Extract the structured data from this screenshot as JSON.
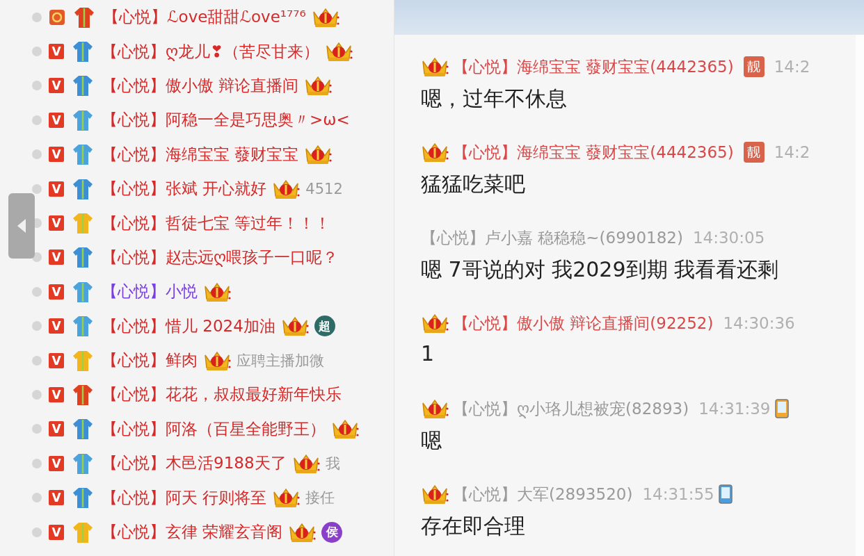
{
  "user_list": [
    {
      "online": false,
      "badge": {
        "kind": "medal"
      },
      "shirt": {
        "color": "#e0401e"
      },
      "color": "#d42a2a",
      "name": "【心悦】ℒove甜甜ℒove¹⁷⁷⁶",
      "crown": true
    },
    {
      "online": false,
      "badge": {
        "kind": "vip",
        "text": "V"
      },
      "shirt": {
        "color": "#3c8fd6"
      },
      "color": "#d42a2a",
      "name": "【心悦】ღ龙儿❣（苦尽甘来）",
      "crown": true
    },
    {
      "online": false,
      "badge": {
        "kind": "vip",
        "text": "V"
      },
      "shirt": {
        "color": "#3c8fd6"
      },
      "color": "#d42a2a",
      "name": "【心悦】傲小傲 辩论直播间",
      "crown": true
    },
    {
      "online": false,
      "badge": {
        "kind": "vip",
        "text": "V"
      },
      "shirt": {
        "color": "#4aa3dc"
      },
      "color": "#d42a2a",
      "name": "【心悦】阿稳一全是巧思奥〃>ω<",
      "crown": false
    },
    {
      "online": false,
      "badge": {
        "kind": "vip",
        "text": "V"
      },
      "shirt": {
        "color": "#4aa3dc"
      },
      "color": "#d42a2a",
      "name": "【心悦】海绵宝宝 蕟财宝宝",
      "crown": true
    },
    {
      "online": false,
      "badge": {
        "kind": "vip",
        "text": "V"
      },
      "shirt": {
        "color": "#3c8fd6"
      },
      "color": "#d42a2a",
      "name": "【心悦】张斌 开心就好",
      "crown": true,
      "message": "4512"
    },
    {
      "online": false,
      "badge": {
        "kind": "vip",
        "text": "V"
      },
      "shirt": {
        "color": "#f2b51c"
      },
      "color": "#d42a2a",
      "name": "【心悦】哲徒七宝 等过年！！！",
      "crown": false
    },
    {
      "online": false,
      "badge": {
        "kind": "vip",
        "text": "V"
      },
      "shirt": {
        "color": "#3c8fd6"
      },
      "color": "#d42a2a",
      "name": "【心悦】赵志远ღ喂孩子一口呢？",
      "crown": false
    },
    {
      "online": false,
      "badge": {
        "kind": "vip",
        "text": "V"
      },
      "shirt": {
        "color": "#4aa3dc"
      },
      "color": "#7a3fe0",
      "name": "【心悦】小悦",
      "crown": true
    },
    {
      "online": false,
      "badge": {
        "kind": "vip",
        "text": "V"
      },
      "shirt": {
        "color": "#4aa3dc"
      },
      "color": "#d42a2a",
      "name": "【心悦】惜儿 2024加油",
      "crown": true,
      "tag": {
        "text": "超",
        "color": "#2f6b66"
      }
    },
    {
      "online": false,
      "badge": {
        "kind": "vip",
        "text": "V"
      },
      "shirt": {
        "color": "#f2b51c"
      },
      "color": "#d42a2a",
      "name": "【心悦】鲜肉",
      "crown": true,
      "message": "应聘主播加微"
    },
    {
      "online": false,
      "badge": {
        "kind": "vip",
        "text": "V"
      },
      "shirt": {
        "color": "#e0401e"
      },
      "color": "#d42a2a",
      "name": "【心悦】花花，叔叔最好新年快乐",
      "crown": false
    },
    {
      "online": false,
      "badge": {
        "kind": "vip",
        "text": "V"
      },
      "shirt": {
        "color": "#3c8fd6"
      },
      "color": "#d42a2a",
      "name": "【心悦】阿洛（百星全能野王）",
      "crown": true
    },
    {
      "online": false,
      "badge": {
        "kind": "vip",
        "text": "V"
      },
      "shirt": {
        "color": "#4aa3dc"
      },
      "color": "#d42a2a",
      "name": "【心悦】木邑活9188天了",
      "crown": true,
      "message": "我"
    },
    {
      "online": false,
      "badge": {
        "kind": "vip",
        "text": "V"
      },
      "shirt": {
        "color": "#3c8fd6"
      },
      "color": "#d42a2a",
      "name": "【心悦】阿天 行则将至",
      "crown": true,
      "message": "接任"
    },
    {
      "online": false,
      "badge": {
        "kind": "vip",
        "text": "V"
      },
      "shirt": {
        "color": "#f2b51c"
      },
      "color": "#d42a2a",
      "name": "【心悦】玄律 荣耀玄音阁",
      "crown": true,
      "tag": {
        "text": "侯",
        "color": "#8a3fc8"
      }
    }
  ],
  "chat": [
    {
      "crown": true,
      "color": "#d84848",
      "name": "【心悦】海绵宝宝 蕟财宝宝(4442365)",
      "tag": "靓",
      "time": "14:2",
      "text": "嗯，过年不休息"
    },
    {
      "crown": true,
      "color": "#d84848",
      "name": "【心悦】海绵宝宝 蕟财宝宝(4442365)",
      "tag": "靓",
      "time": "14:2",
      "text": "猛猛吃菜吧"
    },
    {
      "crown": false,
      "color": "#9a9a9a",
      "name": "【心悦】卢小嘉 稳稳稳~(6990182)",
      "time": "14:30:05",
      "text": "嗯 7哥说的对 我2029到期 我看看还剩"
    },
    {
      "crown": true,
      "color": "#d84848",
      "name": "【心悦】傲小傲 辩论直播间(92252)",
      "time": "14:30:36",
      "text": "1"
    },
    {
      "crown": true,
      "color": "#9a9a9a",
      "name": "【心悦】ღ小珞儿想被宠(82893)",
      "time": "14:31:39",
      "device": {
        "color": "#f0a830"
      },
      "text": "嗯"
    },
    {
      "crown": true,
      "color": "#9a9a9a",
      "name": "【心悦】大军(2893520)",
      "time": "14:31:55",
      "device": {
        "color": "#4a9ee0"
      },
      "text": "存在即合理"
    }
  ]
}
